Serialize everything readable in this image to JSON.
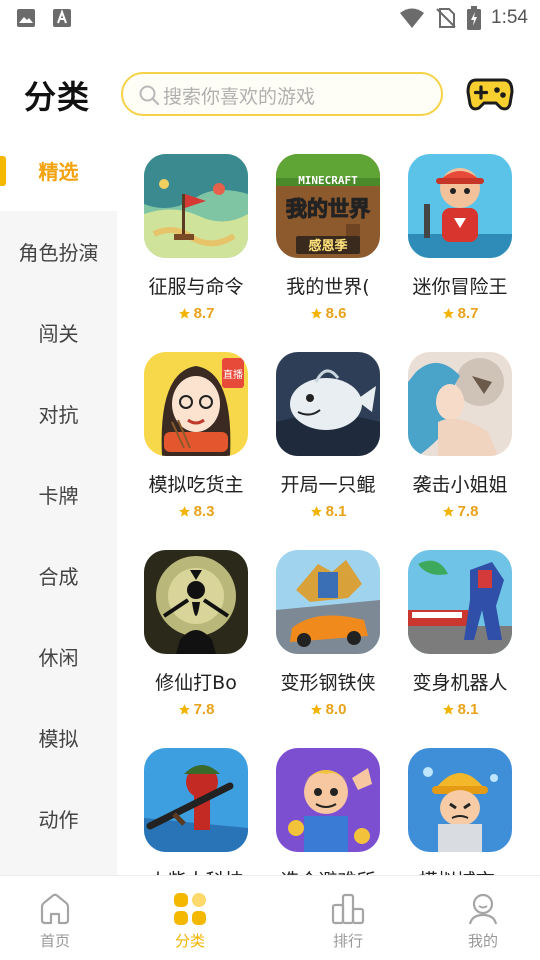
{
  "status_bar": {
    "time": "1:54",
    "left_icons": [
      "image-icon",
      "keyboard-a-icon"
    ],
    "right_icons": [
      "wifi-icon",
      "no-sim-icon",
      "battery-charging-icon"
    ]
  },
  "header": {
    "title": "分类",
    "search_placeholder": "搜索你喜欢的游戏",
    "game_button_icon": "gamepad-icon"
  },
  "colors": {
    "accent": "#f5b800",
    "accent_text": "#f2a30f",
    "rating": "#e8a31a",
    "search_border": "#f5d246",
    "sidebar_bg": "#f6f6f6"
  },
  "sidebar": {
    "items": [
      {
        "label": "精选",
        "active": true
      },
      {
        "label": "角色扮演",
        "active": false
      },
      {
        "label": "闯关",
        "active": false
      },
      {
        "label": "对抗",
        "active": false
      },
      {
        "label": "卡牌",
        "active": false
      },
      {
        "label": "合成",
        "active": false
      },
      {
        "label": "休闲",
        "active": false
      },
      {
        "label": "模拟",
        "active": false
      },
      {
        "label": "动作",
        "active": false
      }
    ]
  },
  "games": [
    {
      "name": "征服与命令",
      "rating": "8.7"
    },
    {
      "name": "我的世界(",
      "rating": "8.6"
    },
    {
      "name": "迷你冒险王",
      "rating": "8.7"
    },
    {
      "name": "模拟吃货主",
      "rating": "8.3"
    },
    {
      "name": "开局一只鲲",
      "rating": "8.1"
    },
    {
      "name": "袭击小姐姐",
      "rating": "7.8"
    },
    {
      "name": "修仙打Bo",
      "rating": "7.8"
    },
    {
      "name": "变形钢铁侠",
      "rating": "8.0"
    },
    {
      "name": "变身机器人",
      "rating": "8.1"
    },
    {
      "name": "火柴人科技",
      "rating": ""
    },
    {
      "name": "造个避难所",
      "rating": ""
    },
    {
      "name": "模拟城市:",
      "rating": ""
    }
  ],
  "icon_art": {
    "minecraft_logo": "MINECRAFT",
    "minecraft_title": "我的世界",
    "minecraft_badge": "感恩季",
    "foodie_badge": "直播"
  },
  "bottom_nav": {
    "items": [
      {
        "label": "首页",
        "icon": "home-icon",
        "active": false
      },
      {
        "label": "分类",
        "icon": "category-icon",
        "active": true
      },
      {
        "label": "排行",
        "icon": "ranking-icon",
        "active": false
      },
      {
        "label": "我的",
        "icon": "profile-icon",
        "active": false
      }
    ]
  }
}
